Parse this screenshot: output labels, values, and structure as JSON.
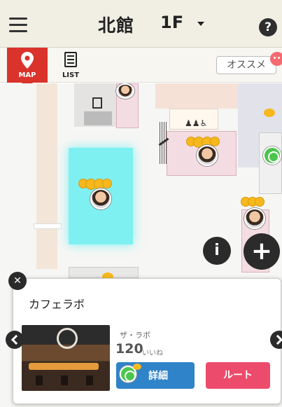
{
  "header": {
    "title": "北館",
    "floor": "1F",
    "menu_icon": "hamburger-icon",
    "help_icon": "question-icon",
    "help_glyph": "?"
  },
  "tabs": {
    "map_label": "MAP",
    "list_label": "LIST",
    "recommend_label": "オススメ",
    "active_color": "#d9332b"
  },
  "map": {
    "highlight_color": "#7ff0f2",
    "info_glyph": "i",
    "add_glyph": "+"
  },
  "card": {
    "close_glyph": "✕",
    "title": "カフェラボ",
    "shop_name": "ザ・ラボ",
    "likes_count": "120",
    "likes_label": "いいね",
    "detail_label": "詳細",
    "route_label": "ルート",
    "detail_color": "#2f83c9",
    "route_color": "#ec4b6c"
  }
}
